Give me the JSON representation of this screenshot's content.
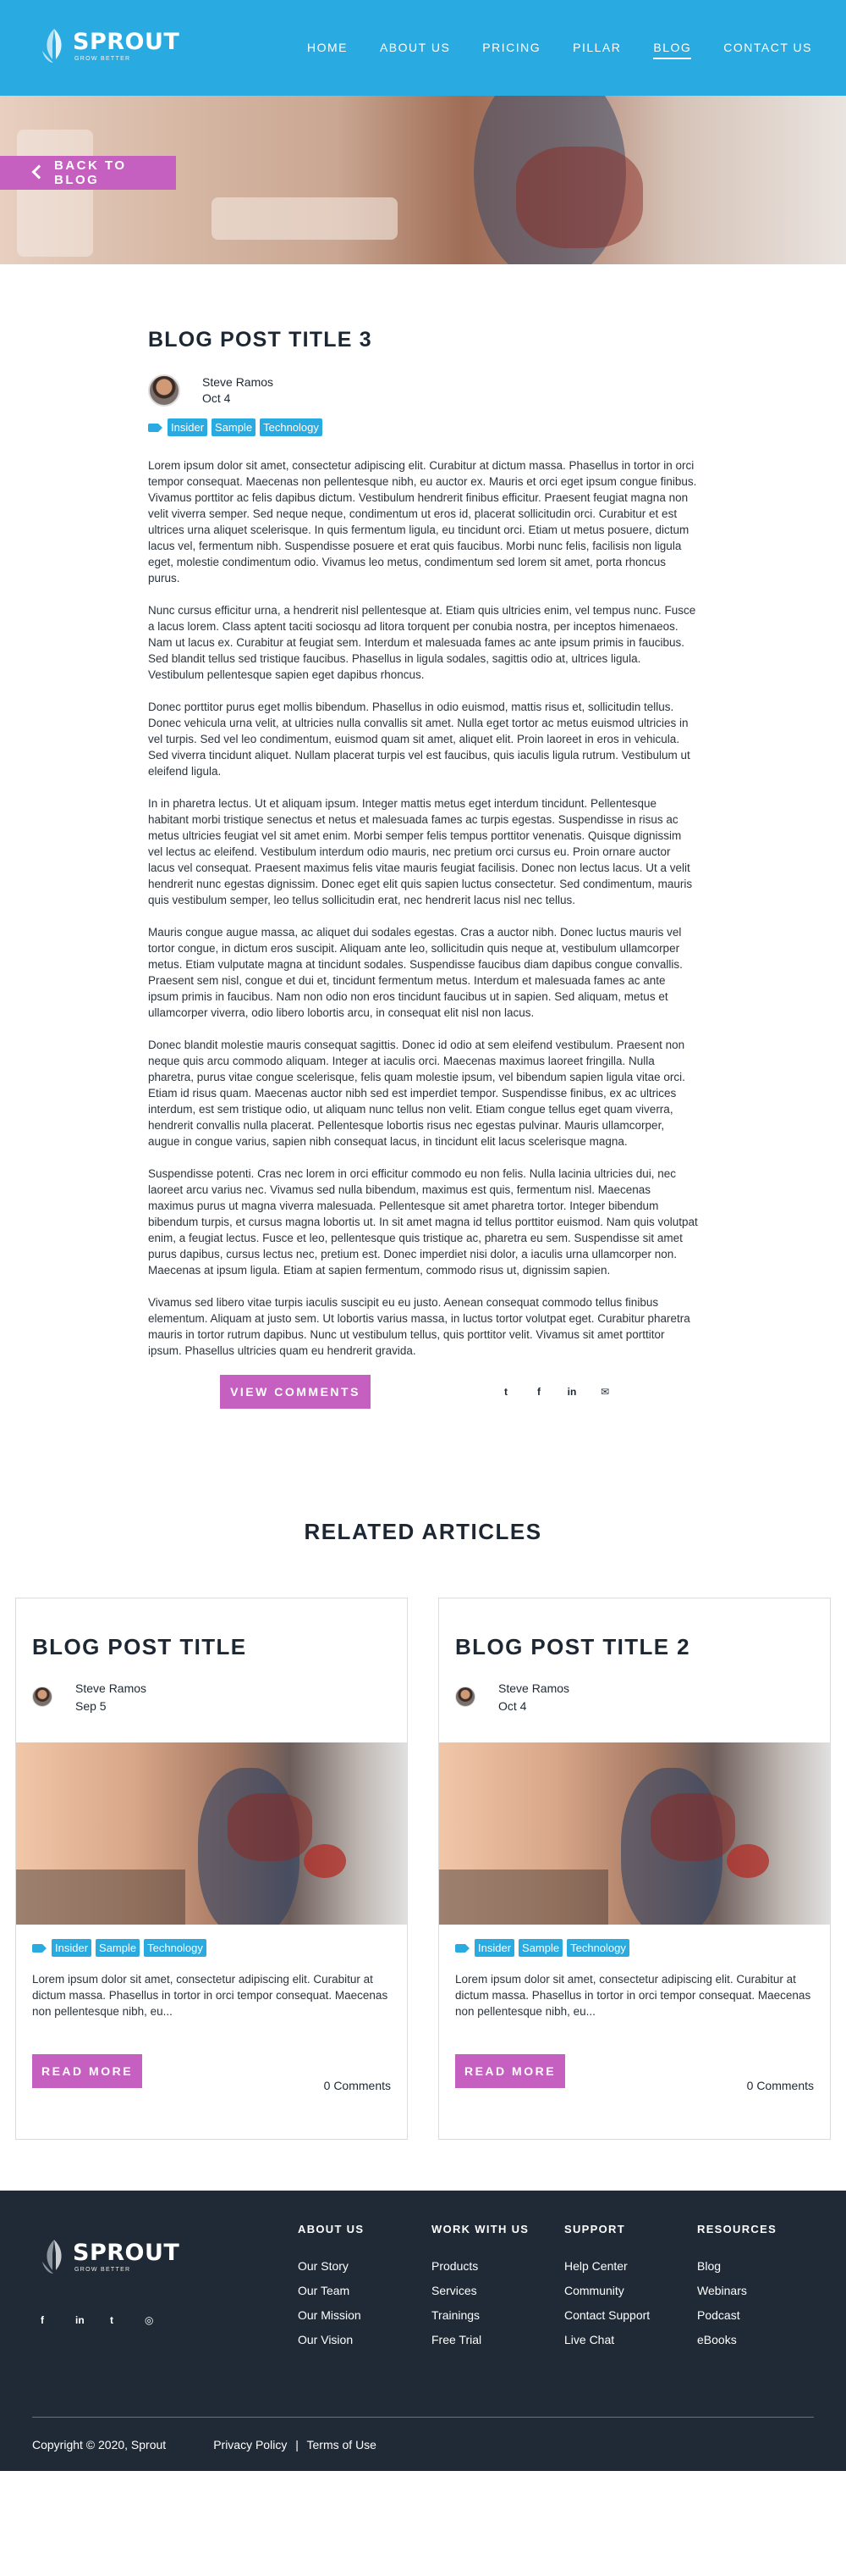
{
  "brand": {
    "name": "SPROUT",
    "tagline": "GROW BETTER"
  },
  "nav": {
    "items": [
      "HOME",
      "ABOUT US",
      "PRICING",
      "PILLAR",
      "BLOG",
      "CONTACT US"
    ],
    "active": "BLOG"
  },
  "hero": {
    "back_label": "BACK TO BLOG"
  },
  "post": {
    "title": "BLOG POST TITLE 3",
    "author": "Steve Ramos",
    "date": "Oct 4",
    "tags": [
      "Insider",
      "Sample",
      "Technology"
    ],
    "paragraphs": [
      "Lorem ipsum dolor sit amet, consectetur adipiscing elit. Curabitur at dictum massa. Phasellus in tortor in orci tempor consequat. Maecenas non pellentesque nibh, eu auctor ex. Mauris et orci eget ipsum congue finibus. Vivamus porttitor ac felis dapibus dictum. Vestibulum hendrerit finibus efficitur. Praesent feugiat magna non velit viverra semper. Sed neque neque, condimentum ut eros id, placerat sollicitudin orci. Curabitur et est ultrices urna aliquet scelerisque. In quis fermentum ligula, eu tincidunt orci. Etiam ut metus posuere, dictum lacus vel, fermentum nibh. Suspendisse posuere et erat quis faucibus. Morbi nunc felis, facilisis non ligula eget, molestie condimentum odio. Vivamus leo metus, condimentum sed lorem sit amet, porta rhoncus purus.",
      "Nunc cursus efficitur urna, a hendrerit nisl pellentesque at. Etiam quis ultricies enim, vel tempus nunc. Fusce a lacus lorem. Class aptent taciti sociosqu ad litora torquent per conubia nostra, per inceptos himenaeos. Nam ut lacus ex. Curabitur at feugiat sem. Interdum et malesuada fames ac ante ipsum primis in faucibus. Sed blandit tellus sed tristique faucibus. Phasellus in ligula sodales, sagittis odio at, ultrices ligula. Vestibulum pellentesque sapien eget dapibus rhoncus.",
      "Donec porttitor purus eget mollis bibendum. Phasellus in odio euismod, mattis risus et, sollicitudin tellus. Donec vehicula urna velit, at ultricies nulla convallis sit amet. Nulla eget tortor ac metus euismod ultricies in vel turpis. Sed vel leo condimentum, euismod quam sit amet, aliquet elit. Proin laoreet in eros in vehicula. Sed viverra tincidunt aliquet. Nullam placerat turpis vel est faucibus, quis iaculis ligula rutrum. Vestibulum ut eleifend ligula.",
      "In in pharetra lectus. Ut et aliquam ipsum. Integer mattis metus eget interdum tincidunt. Pellentesque habitant morbi tristique senectus et netus et malesuada fames ac turpis egestas. Suspendisse in risus ac metus ultricies feugiat vel sit amet enim. Morbi semper felis tempus porttitor venenatis. Quisque dignissim vel lectus ac eleifend. Vestibulum interdum odio mauris, nec pretium orci cursus eu. Proin ornare auctor lacus vel consequat. Praesent maximus felis vitae mauris feugiat facilisis. Donec non lectus lacus. Ut a velit hendrerit nunc egestas dignissim. Donec eget elit quis sapien luctus consectetur. Sed condimentum, mauris quis vestibulum semper, leo tellus sollicitudin erat, nec hendrerit lacus nisl nec tellus.",
      "Mauris congue augue massa, ac aliquet dui sodales egestas. Cras a auctor nibh. Donec luctus mauris vel tortor congue, in dictum eros suscipit. Aliquam ante leo, sollicitudin quis neque at, vestibulum ullamcorper metus. Etiam vulputate magna at tincidunt sodales. Suspendisse faucibus diam dapibus congue convallis. Praesent sem nisl, congue et dui et, tincidunt fermentum metus. Interdum et malesuada fames ac ante ipsum primis in faucibus. Nam non odio non eros tincidunt faucibus ut in sapien. Sed aliquam, metus et ullamcorper viverra, odio libero lobortis arcu, in consequat elit nisl non lacus.",
      "Donec blandit molestie mauris consequat sagittis. Donec id odio at sem eleifend vestibulum. Praesent non neque quis arcu commodo aliquam. Integer at iaculis orci. Maecenas maximus laoreet fringilla. Nulla pharetra, purus vitae congue scelerisque, felis quam molestie ipsum, vel bibendum sapien ligula vitae orci. Etiam id risus quam. Maecenas auctor nibh sed est imperdiet tempor. Suspendisse finibus, ex ac ultrices interdum, est sem tristique odio, ut aliquam nunc tellus non velit. Etiam congue tellus eget quam viverra, hendrerit convallis nulla placerat. Pellentesque lobortis risus nec egestas pulvinar. Mauris ullamcorper, augue in congue varius, sapien nibh consequat lacus, in tincidunt elit lacus scelerisque magna.",
      "Suspendisse potenti. Cras nec lorem in orci efficitur commodo eu non felis. Nulla lacinia ultricies dui, nec laoreet arcu varius nec. Vivamus sed nulla bibendum, maximus est quis, fermentum nisl. Maecenas maximus purus ut magna viverra malesuada. Pellentesque sit amet pharetra tortor. Integer bibendum bibendum turpis, et cursus magna lobortis ut. In sit amet magna id tellus porttitor euismod. Nam quis volutpat enim, a feugiat lectus. Fusce et leo, pellentesque quis tristique ac, pharetra eu sem. Suspendisse sit amet purus dapibus, cursus lectus nec, pretium est. Donec imperdiet nisi dolor, a iaculis urna ullamcorper non. Maecenas at ipsum ligula. Etiam at sapien fermentum, commodo risus ut, dignissim sapien.",
      "Vivamus sed libero vitae turpis iaculis suscipit eu eu justo. Aenean consequat commodo tellus finibus elementum. Aliquam at justo sem. Ut lobortis varius massa, in luctus tortor volutpat eget. Curabitur pharetra mauris in tortor rutrum dapibus. Nunc ut vestibulum tellus, quis porttitor velit. Vivamus sit amet porttitor ipsum. Phasellus ultricies quam eu hendrerit gravida."
    ],
    "view_comments_label": "VIEW COMMENTS",
    "share_icons": [
      "twitter-icon",
      "facebook-icon",
      "linkedin-icon",
      "email-icon"
    ],
    "share_glyphs": [
      "t",
      "f",
      "in",
      "✉"
    ]
  },
  "related": {
    "title": "RELATED ARTICLES",
    "cards": [
      {
        "title": "BLOG POST TITLE",
        "author": "Steve Ramos",
        "date": "Sep 5",
        "tags": [
          "Insider",
          "Sample",
          "Technology"
        ],
        "excerpt": "Lorem ipsum dolor sit amet, consectetur adipiscing elit. Curabitur at dictum massa. Phasellus in tortor in orci tempor consequat. Maecenas non pellentesque nibh, eu...",
        "read_more_label": "READ MORE",
        "comments": "0 Comments"
      },
      {
        "title": "BLOG POST TITLE 2",
        "author": "Steve Ramos",
        "date": "Oct 4",
        "tags": [
          "Insider",
          "Sample",
          "Technology"
        ],
        "excerpt": "Lorem ipsum dolor sit amet, consectetur adipiscing elit. Curabitur at dictum massa. Phasellus in tortor in orci tempor consequat. Maecenas non pellentesque nibh, eu...",
        "read_more_label": "READ MORE",
        "comments": "0 Comments"
      }
    ]
  },
  "footer": {
    "social_icons": [
      "facebook-icon",
      "linkedin-icon",
      "twitter-icon",
      "instagram-icon"
    ],
    "social_glyphs": [
      "f",
      "in",
      "t",
      "◎"
    ],
    "columns": [
      {
        "heading": "ABOUT US",
        "items": [
          "Our Story",
          "Our Team",
          "Our Mission",
          "Our Vision"
        ]
      },
      {
        "heading": "WORK WITH US",
        "items": [
          "Products",
          "Services",
          "Trainings",
          "Free Trial"
        ]
      },
      {
        "heading": "SUPPORT",
        "items": [
          "Help Center",
          "Community",
          "Contact Support",
          "Live Chat"
        ]
      },
      {
        "heading": "RESOURCES",
        "items": [
          "Blog",
          "Webinars",
          "Podcast",
          "eBooks"
        ]
      }
    ],
    "copyright": "Copyright © 2020, Sprout",
    "privacy_label": "Privacy Policy",
    "separator": "|",
    "terms_label": "Terms of Use"
  },
  "colors": {
    "header_bg": "#29abe2",
    "accent_pink": "#c660c0",
    "tag_blue": "#29abe2",
    "footer_bg": "#1f2a36"
  }
}
